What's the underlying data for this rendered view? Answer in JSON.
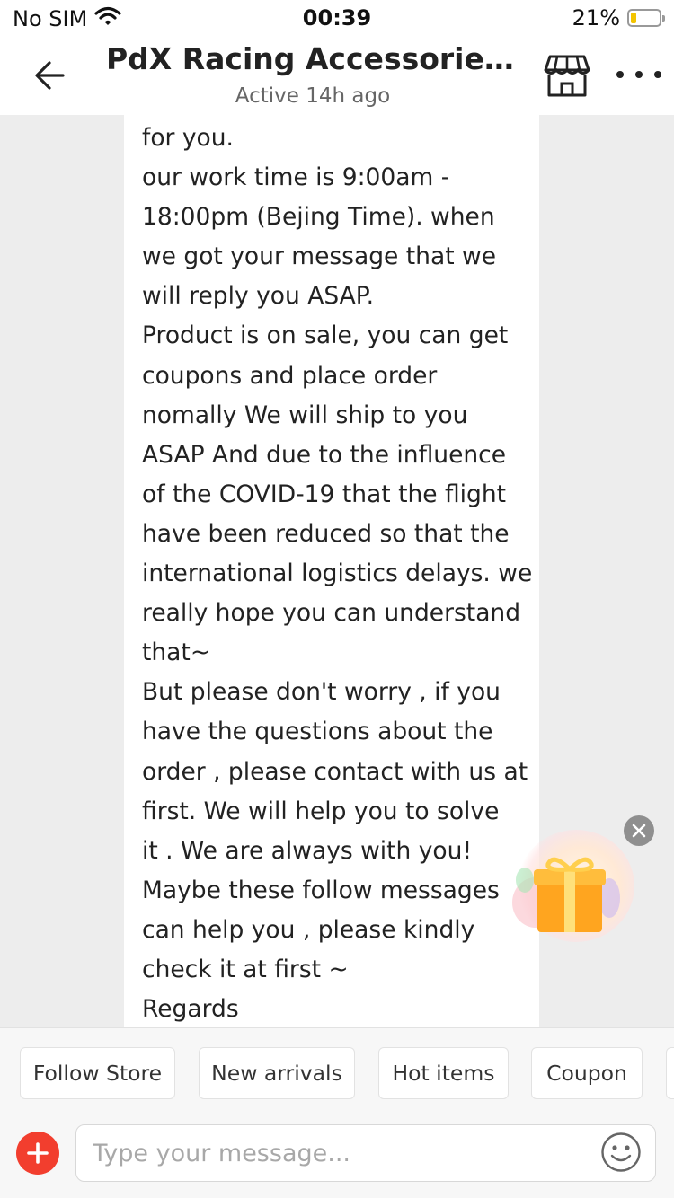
{
  "status_bar": {
    "carrier": "No SIM",
    "time": "00:39",
    "battery_percent": "21%",
    "battery_level": 0.21,
    "icons": [
      "wifi-icon",
      "battery-icon"
    ]
  },
  "header": {
    "title": "PdX Racing Accessories...",
    "subtitle": "Active 14h ago",
    "icons": [
      "back-arrow-icon",
      "store-icon",
      "more-icon"
    ]
  },
  "message": {
    "lines": [
      "for you.",
      "our work time is 9:00am -",
      "18:00pm (Bejing Time). when",
      "we got your message that we",
      "will reply you ASAP.",
      "Product is on sale, you can get",
      "coupons and place order",
      "nomally We will ship to you",
      "ASAP And due to the influence",
      "of the COVID-19 that the flight",
      "have been reduced so that the",
      "international logistics delays. we",
      "really hope you can understand",
      "that~",
      "But please don't worry , if you",
      "have the questions about the",
      "order , please contact with us at",
      "first. We will help you to solve",
      "it . We are always with you!",
      "Maybe these follow messages",
      "can help you , please kindly",
      "check it at first ~",
      "Regards"
    ]
  },
  "floating_gift": {
    "icons": [
      "gift-icon",
      "close-icon"
    ]
  },
  "quick_replies": [
    {
      "label": "Follow Store"
    },
    {
      "label": "New arrivals"
    },
    {
      "label": "Hot items"
    },
    {
      "label": "Coupon"
    },
    {
      "label": ""
    }
  ],
  "input": {
    "placeholder": "Type your message...",
    "value": "",
    "icons": [
      "plus-icon",
      "emoji-icon"
    ]
  },
  "colors": {
    "accent": "#f23e2e",
    "background": "#ededed",
    "bubble": "#ffffff",
    "battery": "#f3c400",
    "gift": "#ffa51f"
  }
}
